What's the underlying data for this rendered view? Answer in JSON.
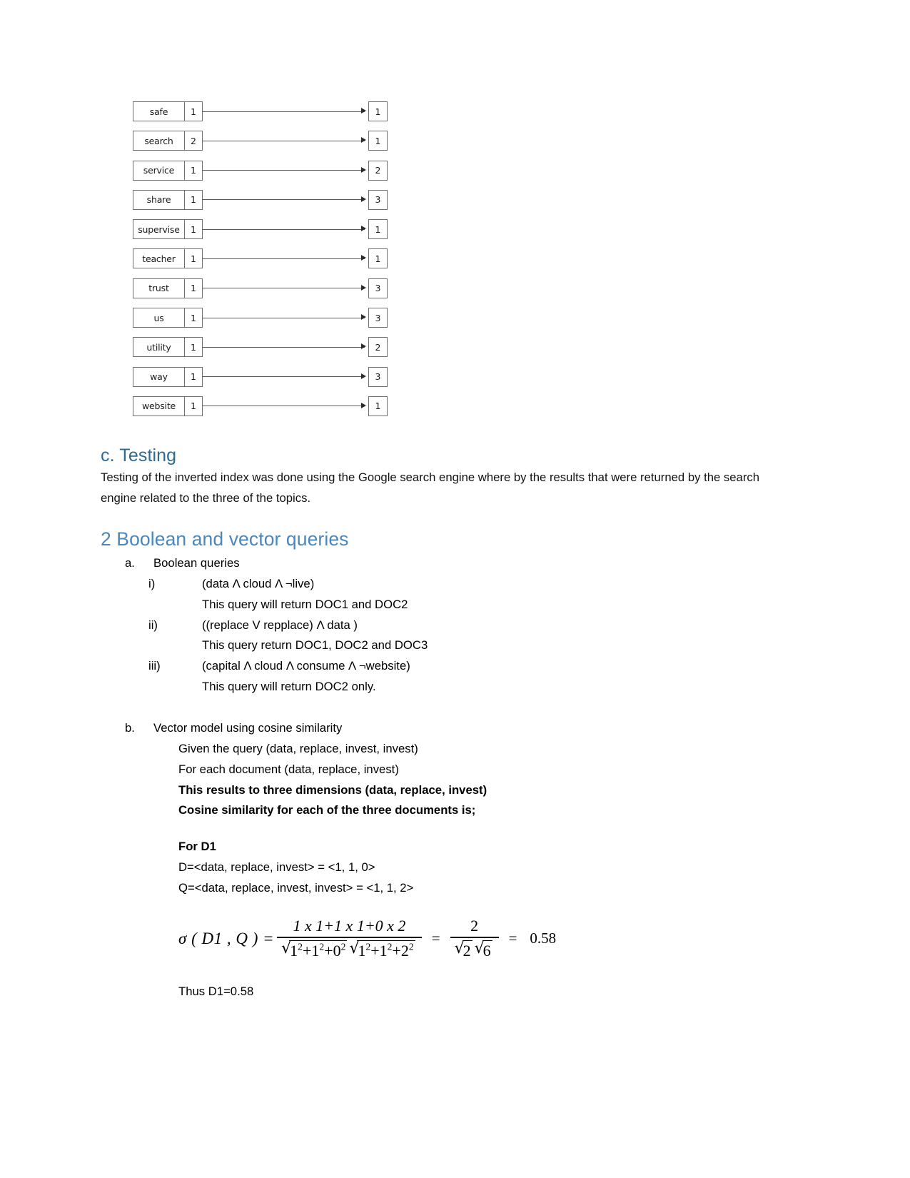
{
  "index_diagram": {
    "label": "inverted-index-postings-diagram",
    "rows": [
      {
        "term": "safe",
        "freq": "1",
        "posting": "1"
      },
      {
        "term": "search",
        "freq": "2",
        "posting": "1"
      },
      {
        "term": "service",
        "freq": "1",
        "posting": "2"
      },
      {
        "term": "share",
        "freq": "1",
        "posting": "3"
      },
      {
        "term": "supervise",
        "freq": "1",
        "posting": "1"
      },
      {
        "term": "teacher",
        "freq": "1",
        "posting": "1"
      },
      {
        "term": "trust",
        "freq": "1",
        "posting": "3"
      },
      {
        "term": "us",
        "freq": "1",
        "posting": "3"
      },
      {
        "term": "utility",
        "freq": "1",
        "posting": "2"
      },
      {
        "term": "way",
        "freq": "1",
        "posting": "3"
      },
      {
        "term": "website",
        "freq": "1",
        "posting": "1"
      }
    ]
  },
  "sections": {
    "testing": {
      "heading": "c. Testing",
      "paragraph": "Testing of the inverted index was done using the Google search engine where by the results that were returned by the search engine related to the three of the topics."
    },
    "queries": {
      "heading": "2 Boolean and vector queries",
      "boolean": {
        "marker": "a.",
        "title": "Boolean queries",
        "items": [
          {
            "marker": "i)",
            "query": "(data Λ cloud Λ ¬live)",
            "result": "This query will return DOC1 and DOC2"
          },
          {
            "marker": "ii)",
            "query": " ((replace V repplace)  Λ data  )",
            "result": "This query return DOC1, DOC2 and DOC3"
          },
          {
            "marker": "iii)",
            "query": "(capital Λ cloud Λ consume Λ ¬website)",
            "result": "This query will return DOC2 only."
          }
        ]
      },
      "vector": {
        "marker": "b.",
        "title": "Vector  model using cosine similarity",
        "given_query": "Given the query (data, replace, invest, invest)",
        "for_each_document": "For each document (data, replace, invest)",
        "dimensions_note": "This results to three dimensions (data, replace, invest)",
        "cosine_note": "Cosine similarity for each of the three documents is;",
        "d1": {
          "label": "For D1",
          "document_vector": "D=<data, replace, invest> = <1, 1, 0>",
          "query_vector": "Q=<data, replace, invest, invest> = <1, 1, 2>",
          "formula": {
            "lhs": "σ ( D1 , Q ) =",
            "numerator": "1 x 1+1 x 1+0 x 2",
            "denominator_sqrt1": "1²+1²+0²",
            "denominator_sqrt2": "1²+1²+2²",
            "equals": "=",
            "simplified_numerator": "2",
            "simplified_den_sqrt1": "2",
            "simplified_den_sqrt2": "6",
            "final_equals": "=",
            "value": "0.58"
          },
          "conclusion": "Thus D1=0.58"
        }
      }
    }
  },
  "colors": {
    "heading_sub": "#2e6a96",
    "heading_main": "#4a87bd",
    "body": "#121212",
    "box_border": "#6e6e6e"
  }
}
